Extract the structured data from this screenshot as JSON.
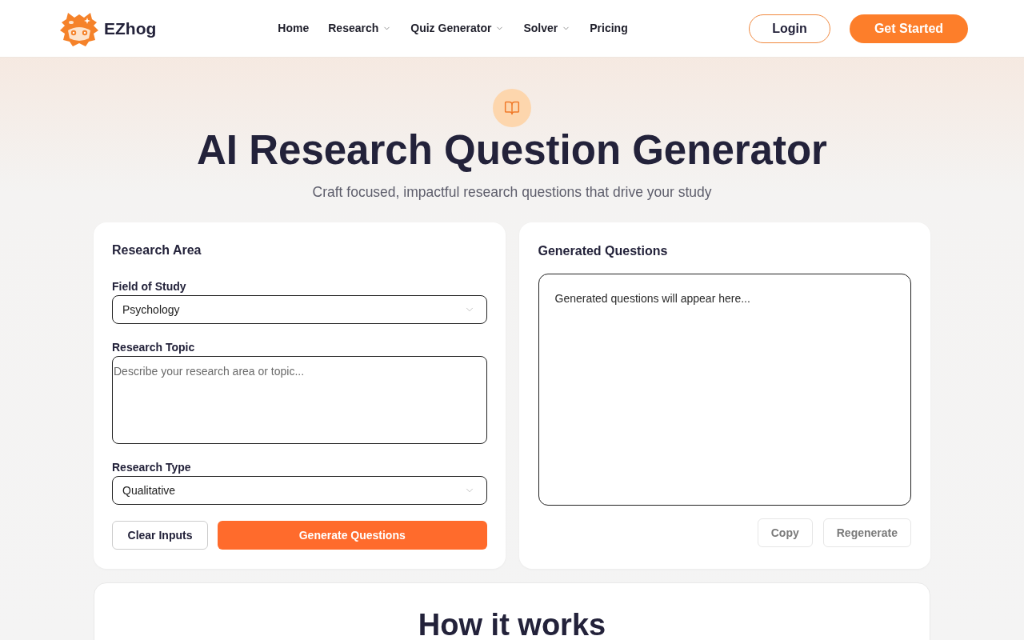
{
  "header": {
    "logo": {
      "text": "EZhog"
    },
    "nav": [
      {
        "label": "Home",
        "dropdown": false
      },
      {
        "label": "Research",
        "dropdown": true
      },
      {
        "label": "Quiz Generator",
        "dropdown": true
      },
      {
        "label": "Solver",
        "dropdown": true
      },
      {
        "label": "Pricing",
        "dropdown": false
      }
    ],
    "buttons": [
      {
        "label": "Login",
        "kind": "outline"
      },
      {
        "label": "Get Started",
        "kind": "primary"
      }
    ]
  },
  "hero": {
    "title": "AI Research Question Generator",
    "subtitle": "Craft focused, impactful research questions that drive your study"
  },
  "form": {
    "title": "Research Area",
    "fields": [
      {
        "kind": "select",
        "label": "Field of Study",
        "value": "Psychology"
      },
      {
        "kind": "textarea",
        "label": "Research Topic",
        "placeholder": "Describe your research area or topic..."
      },
      {
        "kind": "select",
        "label": "Research Type",
        "value": "Qualitative"
      }
    ],
    "buttons": [
      {
        "label": "Clear Inputs",
        "kind": "secondary"
      },
      {
        "label": "Generate Questions",
        "kind": "primary"
      }
    ]
  },
  "output": {
    "title": "Generated Questions",
    "empty_message": "Generated questions will appear here...",
    "buttons": [
      {
        "label": "Copy",
        "disabled": true
      },
      {
        "label": "Regenerate",
        "disabled": true
      }
    ]
  },
  "how_it_works": {
    "title": "How it works"
  }
}
